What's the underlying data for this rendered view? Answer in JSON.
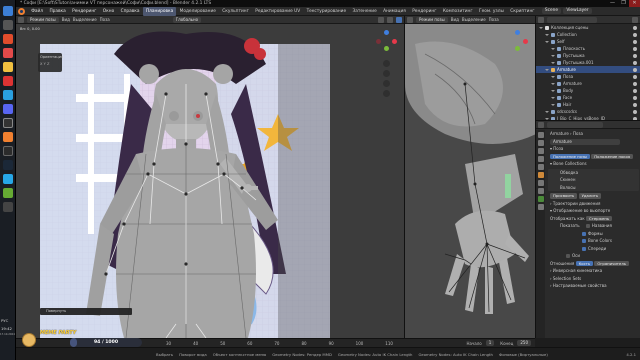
{
  "window": {
    "title": "* Софи [E:\\Soft\\STuton\\анимки VT персонажей\\Софи\\Софи.blend] - Blender 4.2.1 LTS",
    "controls": [
      "—",
      "❐",
      "✕"
    ]
  },
  "menubar": {
    "items": [
      "Файл",
      "Правка",
      "Рендеринг",
      "Окно",
      "Справка"
    ],
    "workspaces": [
      "Планировка",
      "Моделирование",
      "Скульптинг",
      "Редактирование UV",
      "Текстурирование",
      "Затенение",
      "Анимация",
      "Рендеринг",
      "Композитинг",
      "Геом. узлы",
      "Скриптинг"
    ],
    "active_workspace": "Планировка",
    "scene": "Scene",
    "view_layer": "ViewLayer"
  },
  "viewport_main": {
    "header_mode": "Режим позы",
    "header_menus": [
      "Вид",
      "Выделение",
      "Поза"
    ],
    "transform": "Глобально",
    "stats": "Вн: 0, 0.00",
    "overlay_label": "Ориентация",
    "overlay_values": "X  Y  Z",
    "undo_text": "Повернуть"
  },
  "viewport_side": {
    "header_mode": "Режим позы",
    "header_menus": [
      "Вид",
      "Выделение",
      "Поза"
    ]
  },
  "outliner": {
    "title": "Коллекция сцены",
    "rows": [
      {
        "label": "Коллекция сцены",
        "indent": 0,
        "selected": false
      },
      {
        "label": "Collection",
        "indent": 1,
        "selected": false
      },
      {
        "label": "Self",
        "indent": 1,
        "selected": false
      },
      {
        "label": "Плоскость",
        "indent": 2,
        "selected": false
      },
      {
        "label": "Пустышка",
        "indent": 2,
        "selected": false
      },
      {
        "label": "Пустышка.001",
        "indent": 2,
        "selected": false
      },
      {
        "label": "Armature",
        "indent": 1,
        "selected": true
      },
      {
        "label": "Поза",
        "indent": 2,
        "selected": false
      },
      {
        "label": "Armature",
        "indent": 2,
        "selected": false
      },
      {
        "label": "Body",
        "indent": 2,
        "selected": false
      },
      {
        "label": "Face",
        "indent": 2,
        "selected": false
      },
      {
        "label": "Hair",
        "indent": 2,
        "selected": false
      },
      {
        "label": "sdcscsdcs",
        "indent": 1,
        "selected": false
      },
      {
        "label": "J_Bip_C_Hips_vsBone_ID",
        "indent": 1,
        "selected": false
      }
    ]
  },
  "properties": {
    "breadcrumb": [
      "Armature",
      "Поза"
    ],
    "object_name": "Armature",
    "section_pose": "Поза",
    "pose_position": "Положение позы",
    "rest_position": "Положение покоя",
    "collections_title": "Bone Collections",
    "collections": [
      "Обводка",
      "Скинен",
      "Волосы"
    ],
    "assign": "Присвоить",
    "remove": "Удалить",
    "motion_section": "Траектории движения",
    "viewport_section": "Отображение во вьюпорте",
    "display_as_label": "Отображать как",
    "display_as_value": "Стержень",
    "show_label": "Показать",
    "checks": [
      {
        "label": "Названия",
        "on": false
      },
      {
        "label": "Формы",
        "on": true
      },
      {
        "label": "Bone Colors",
        "on": true
      },
      {
        "label": "Спереди",
        "on": true
      }
    ],
    "axes_label": "Оси",
    "relations_label": "Отношения",
    "relations_values": [
      "Кость",
      "Ограничитель"
    ],
    "ik_section": "Инверсная кинематика",
    "selection_sets": "Selection Sets",
    "custom_props": "Настраиваемые свойства"
  },
  "timeline": {
    "ticks": [
      "30",
      "40",
      "50",
      "60",
      "70",
      "80",
      "90",
      "100",
      "110"
    ],
    "start_label": "Начало",
    "start_value": "1",
    "end_label": "Конец",
    "end_value": "250"
  },
  "statusbar": {
    "items": [
      "Выбрать",
      "Поворот вида",
      "Объект контекстное меню",
      "Geometry Nodes: Рендер MMD",
      "Geometry Nodes: Auto IK Chain Length",
      "Geometry Nodes: Auto IK Chain Length",
      "Фоновые (Виртуальные)",
      "4.2.1"
    ]
  },
  "stream_widget": {
    "label": "MEME PARTY",
    "progress": "94 / 1000",
    "progress_fraction": 0.094
  },
  "taskbar": {
    "clock": "19:42",
    "date": "17.10.2024",
    "lang": "РУС"
  },
  "colors": {
    "accent": "#4772b3",
    "selected": "#334d80",
    "blender_orange": "#f08030",
    "gizmo_x": "#e6394a",
    "gizmo_y": "#7cbb3b",
    "gizmo_z": "#3f7fe0"
  }
}
